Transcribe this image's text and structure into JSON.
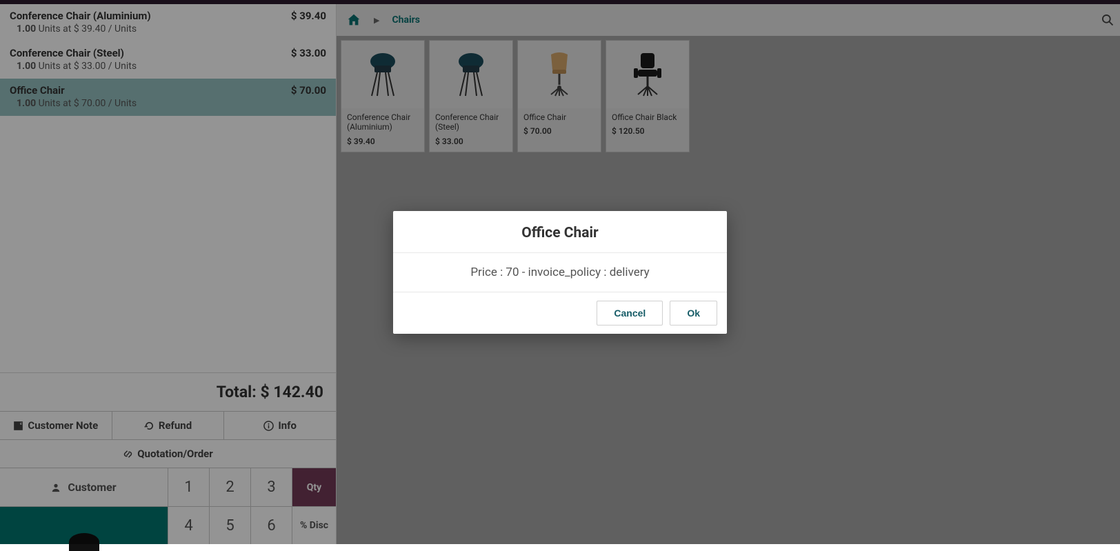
{
  "order": {
    "lines": [
      {
        "name": "Conference Chair (Aluminium)",
        "price": "$ 39.40",
        "qty": "1.00",
        "detail": "Units at $ 39.40 / Units",
        "selected": false
      },
      {
        "name": "Conference Chair (Steel)",
        "price": "$ 33.00",
        "qty": "1.00",
        "detail": "Units at $ 33.00 / Units",
        "selected": false
      },
      {
        "name": "Office Chair",
        "price": "$ 70.00",
        "qty": "1.00",
        "detail": "Units at $ 70.00 / Units",
        "selected": true
      }
    ],
    "total_label": "Total: ",
    "total_value": "$ 142.40"
  },
  "actions": {
    "customer_note": "Customer Note",
    "refund": "Refund",
    "info": "Info",
    "quotation": "Quotation/Order",
    "customer": "Customer",
    "qty": "Qty",
    "disc": "% Disc"
  },
  "numpad": {
    "row1": [
      "1",
      "2",
      "3"
    ],
    "row2": [
      "4",
      "5",
      "6"
    ]
  },
  "breadcrumb": {
    "category": "Chairs"
  },
  "products": [
    {
      "name": "Conference Chair (Aluminium)",
      "price": "$ 39.40"
    },
    {
      "name": "Conference Chair (Steel)",
      "price": "$ 33.00"
    },
    {
      "name": "Office Chair",
      "price": "$ 70.00"
    },
    {
      "name": "Office Chair Black",
      "price": "$ 120.50"
    }
  ],
  "modal": {
    "title": "Office Chair",
    "body": "Price : 70 - invoice_policy : delivery",
    "cancel": "Cancel",
    "ok": "Ok"
  }
}
